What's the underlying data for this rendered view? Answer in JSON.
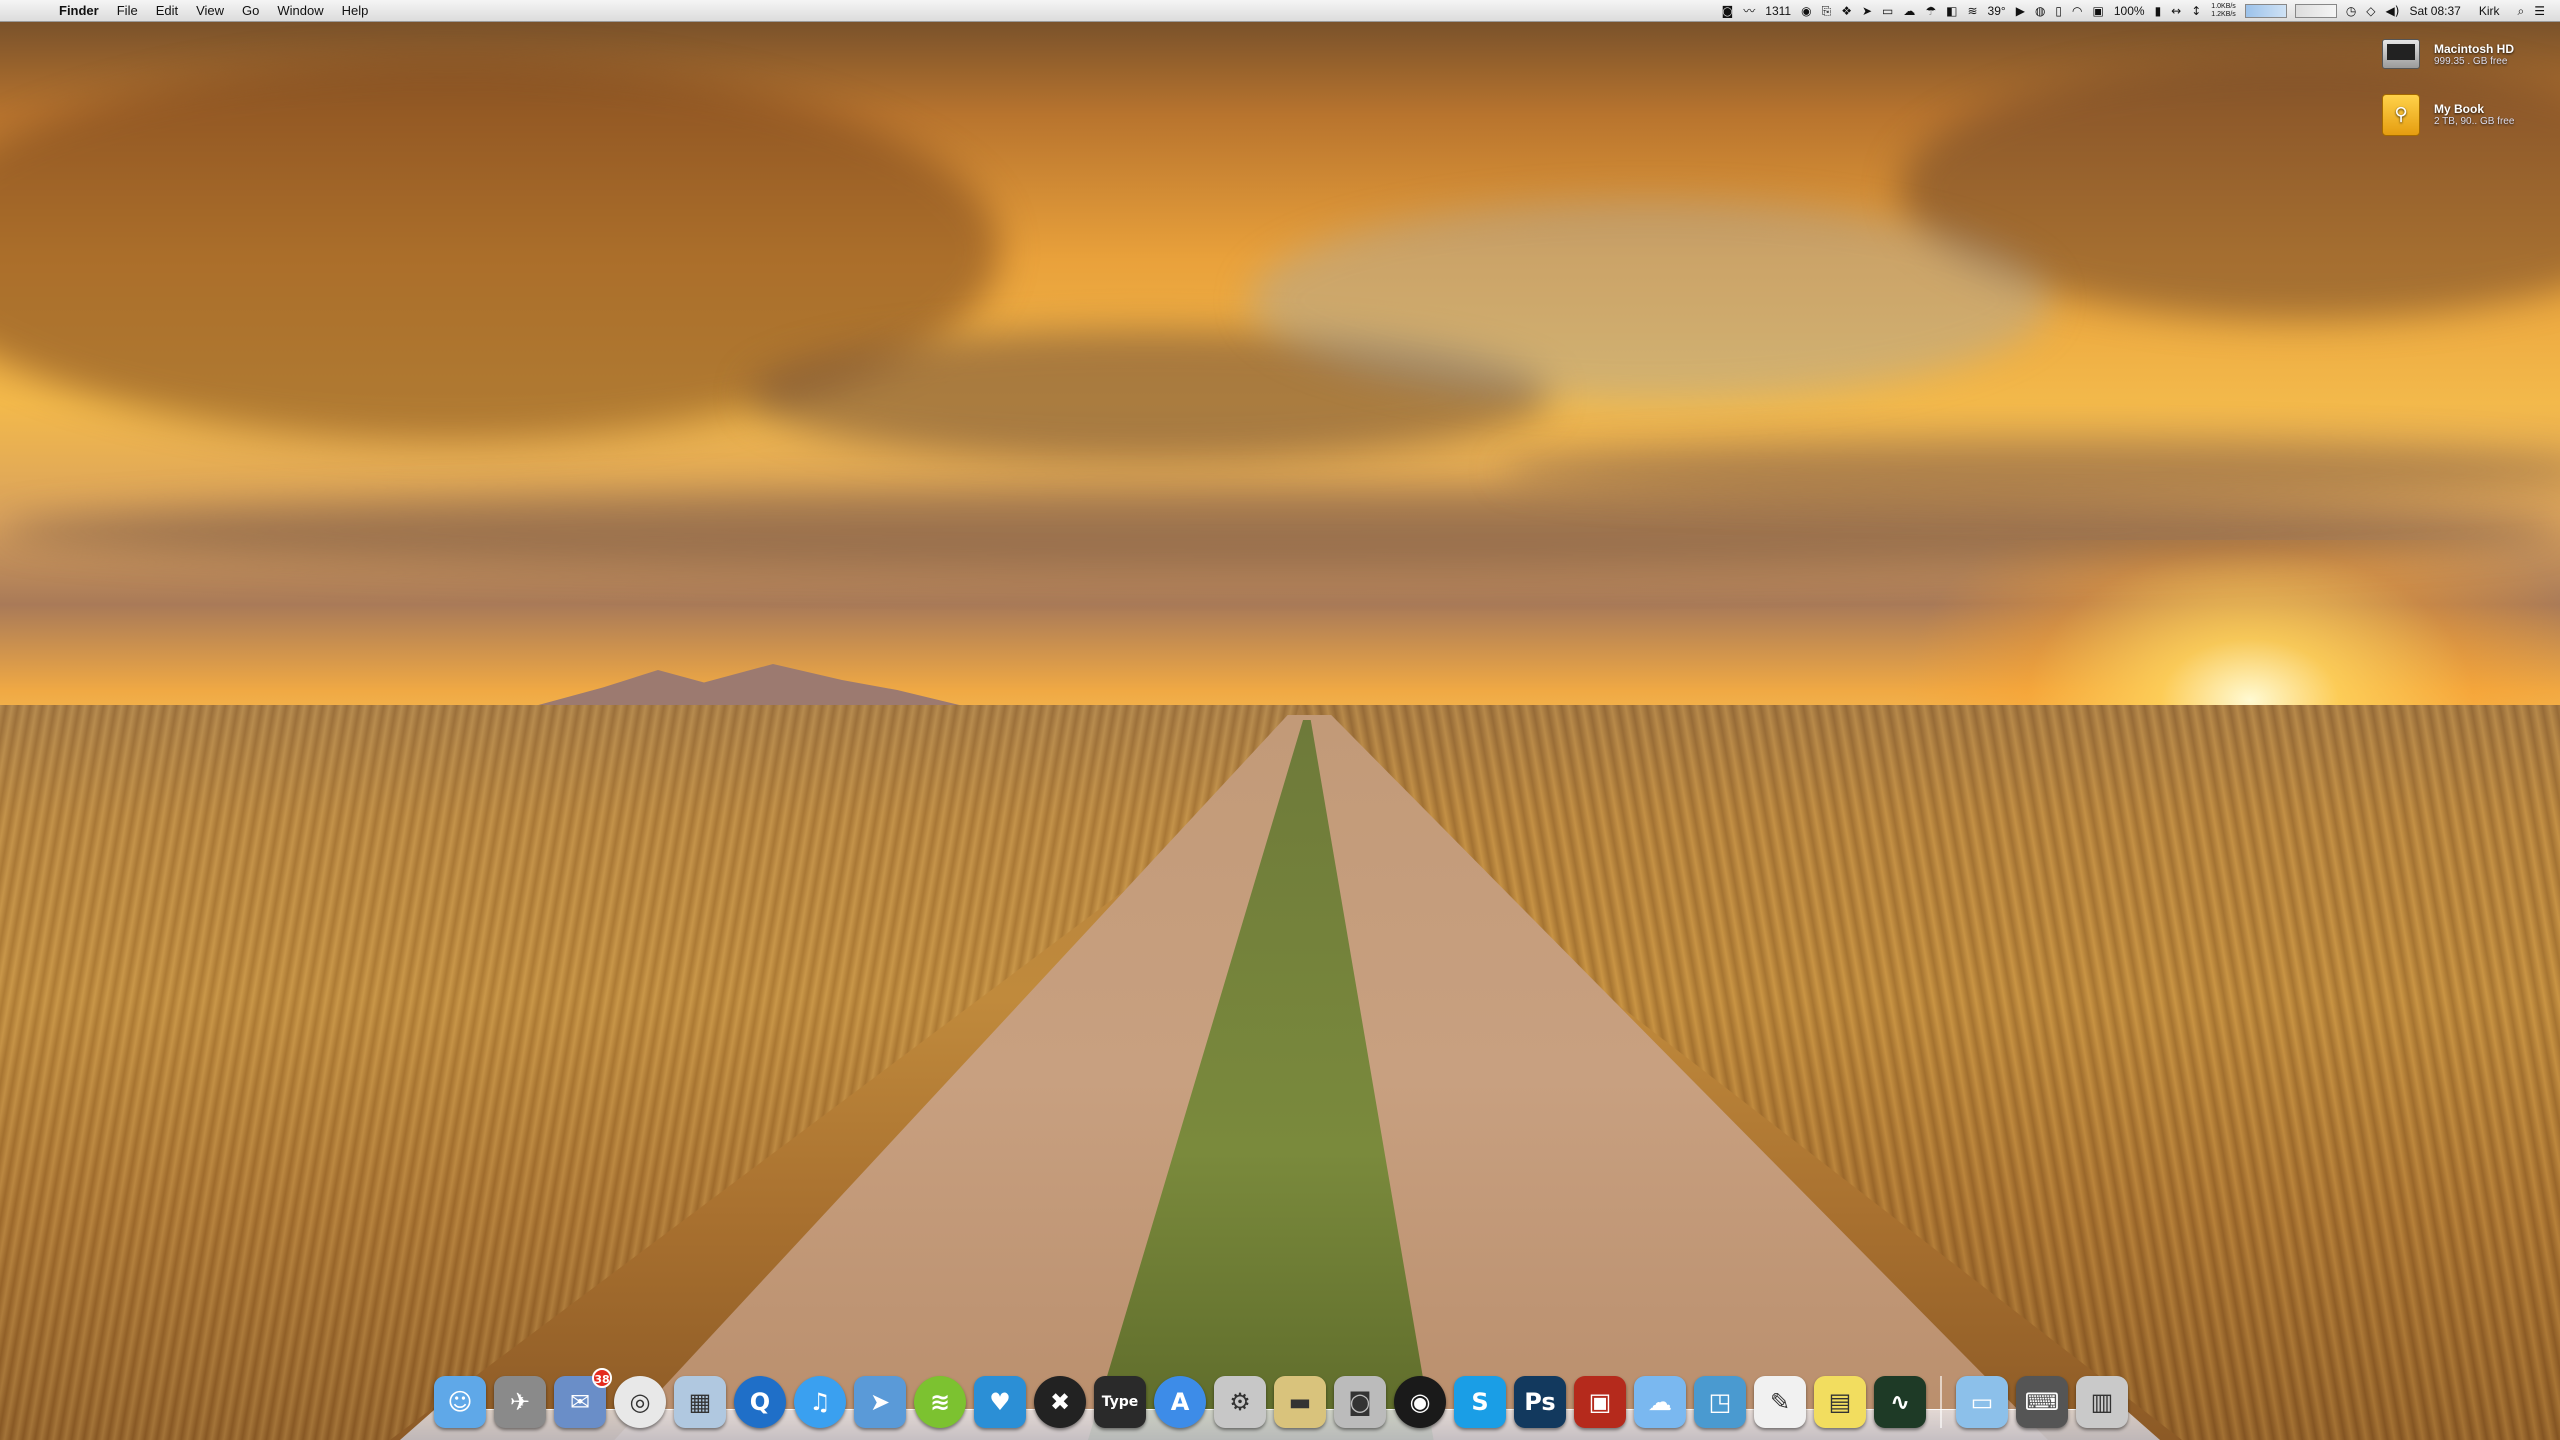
{
  "menubar": {
    "app_name": "Finder",
    "menus": [
      "File",
      "Edit",
      "View",
      "Go",
      "Window",
      "Help"
    ],
    "status": {
      "counter": "1311",
      "temperature": "39°",
      "battery": "100%",
      "net_up": "1.0KB/s",
      "net_down": "1.2KB/s",
      "clock": "Sat 08:37",
      "user": "Kirk"
    }
  },
  "desktop": {
    "drives": [
      {
        "name": "Macintosh HD",
        "info": "999.35 . GB free",
        "icon": "hard-drive-icon"
      },
      {
        "name": "My Book",
        "info": "2 TB, 90.. GB free",
        "icon": "external-drive-icon"
      }
    ]
  },
  "dock": {
    "apps": [
      {
        "name": "Finder",
        "icon": "finder-icon",
        "color": "#5fa8e8"
      },
      {
        "name": "Launchpad",
        "icon": "launchpad-icon",
        "color": "#8a8a8a"
      },
      {
        "name": "Mail",
        "icon": "mail-stamp-icon",
        "color": "#6a8ec8",
        "badge": "38"
      },
      {
        "name": "Chrome",
        "icon": "chrome-icon",
        "color": "#e8e8e8"
      },
      {
        "name": "Preview",
        "icon": "preview-icon",
        "color": "#b0c8e0"
      },
      {
        "name": "QuickTime",
        "icon": "quicktime-icon",
        "color": "#1f6fc8"
      },
      {
        "name": "iTunes",
        "icon": "itunes-icon",
        "color": "#3aa0f0"
      },
      {
        "name": "Sparrow",
        "icon": "paper-plane-icon",
        "color": "#5a9ad8"
      },
      {
        "name": "Spotify",
        "icon": "spotify-icon",
        "color": "#7cc230"
      },
      {
        "name": "Twitter",
        "icon": "twitter-bird-icon",
        "color": "#2b8fd6"
      },
      {
        "name": "CrossOver",
        "icon": "crossover-icon",
        "color": "#222222"
      },
      {
        "name": "Type2Phone",
        "icon": "type2phone-icon",
        "color": "#2a2a2a",
        "label": "Type"
      },
      {
        "name": "App Store",
        "icon": "app-store-icon",
        "color": "#3d8ce8"
      },
      {
        "name": "Automator",
        "icon": "automator-icon",
        "color": "#c7c7c7"
      },
      {
        "name": "Transmit",
        "icon": "truck-icon",
        "color": "#d9c37c"
      },
      {
        "name": "Screenshot",
        "icon": "camera-icon",
        "color": "#bbbbbb"
      },
      {
        "name": "FaceTime",
        "icon": "webcam-icon",
        "color": "#1a1a1a"
      },
      {
        "name": "Skype",
        "icon": "skype-icon",
        "color": "#1a9ee6",
        "label": "S"
      },
      {
        "name": "Photoshop",
        "icon": "photoshop-icon",
        "color": "#12395e",
        "label": "Ps"
      },
      {
        "name": "Photo Booth",
        "icon": "photo-booth-icon",
        "color": "#b52a1c"
      },
      {
        "name": "Messages",
        "icon": "messages-icon",
        "color": "#7ab8f0"
      },
      {
        "name": "Boot Camp",
        "icon": "boot-camp-icon",
        "color": "#4a9ad0"
      },
      {
        "name": "TextEdit",
        "icon": "textedit-icon",
        "color": "#f1f1f1"
      },
      {
        "name": "Stickies",
        "icon": "stickies-icon",
        "color": "#f2dd5f"
      },
      {
        "name": "Activity Monitor",
        "icon": "activity-monitor-icon",
        "color": "#1e3a26"
      }
    ],
    "right_items": [
      {
        "name": "Applications",
        "icon": "folder-icon",
        "color": "#8cc0ea"
      },
      {
        "name": "Keyboard Viewer",
        "icon": "keyboard-icon",
        "color": "#555555"
      },
      {
        "name": "Trash",
        "icon": "trash-icon",
        "color": "#c9c9c9"
      }
    ]
  }
}
